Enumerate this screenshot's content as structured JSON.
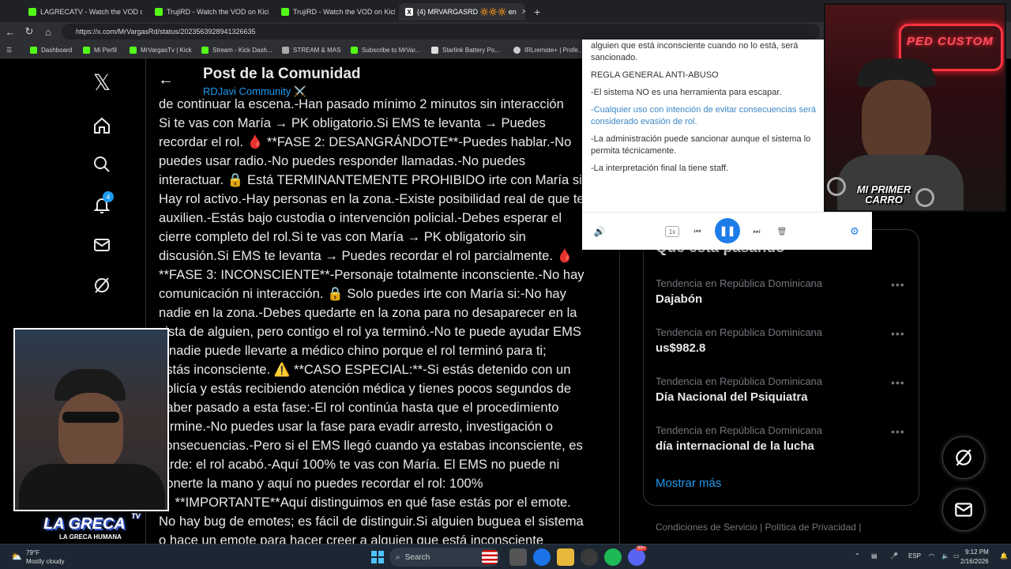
{
  "browser": {
    "tabs": [
      {
        "title": "LAGRECATV - Watch the VOD on K",
        "favicon": "kick-icon"
      },
      {
        "title": "TrujiRD - Watch the VOD on Kick",
        "favicon": "kick-icon"
      },
      {
        "title": "TrujiRD - Watch the VOD on Kick",
        "favicon": "kick-icon"
      },
      {
        "title": "(4) MRVARGASRD 🔆🔆🔆 en",
        "favicon": "x-icon"
      }
    ],
    "new_tab": "+",
    "url": "https://x.com/MrVargasRd/status/2023563928941326635",
    "bookmarks": [
      "Dashboard",
      "Mi Perfil",
      "MrVargasTv | Kick",
      "Stream - Kick Dash...",
      "STREAM & MAS",
      "Subscribe to MrVar...",
      "Starlink Battery Po...",
      "IRLremote+ | Profe..."
    ]
  },
  "sidebar": {
    "icons": [
      "x-logo-icon",
      "home-icon",
      "search-icon",
      "notifications-icon",
      "messages-icon",
      "grok-icon"
    ],
    "notification_count": "4"
  },
  "post": {
    "title": "Post de la Comunidad",
    "community": "RDJavi Community ⚔️",
    "lines": [
      "de continuar la escena.-Han pasado mínimo 2 minutos sin interacción",
      "Si te vas con María → PK obligatorio.Si EMS te levanta → Puedes",
      "recordar el rol. 🩸 **FASE 2: DESANGRÁNDOTE**-Puedes hablar.-No",
      "puedes usar radio.-No puedes responder llamadas.-No puedes",
      "interactuar. 🔒 Está TERMINANTEMENTE PROHIBIDO irte con María si:",
      "Hay rol activo.-Hay personas en la zona.-Existe posibilidad real de que te",
      "auxilien.-Estás bajo custodia o intervención policial.-Debes esperar el",
      "cierre completo del rol.Si te vas con María → PK obligatorio sin",
      "discusión.Si EMS te levanta → Puedes recordar el rol parcialmente. 🩸",
      "**FASE 3: INCONSCIENTE**-Personaje totalmente inconsciente.-No hay",
      "comunicación ni interacción. 🔒 Solo puedes irte con María si:-No hay",
      "nadie en la zona.-Debes quedarte en la zona para no desaparecer en la",
      "vista de alguien, pero contigo el rol ya terminó.-No te puede ayudar EMS",
      "y nadie puede llevarte a médico chino porque el rol terminó para ti;",
      "estás inconsciente. ⚠️ **CASO ESPECIAL:**-Si estás detenido con un",
      "policía y estás recibiendo atención médica y tienes pocos segundos de",
      "haber pasado a esta fase:-El rol continúa hasta que el procedimiento",
      "termine.-No puedes usar la fase para evadir arresto, investigación o",
      "consecuencias.-Pero si el EMS llegó cuando ya estabas inconsciente, es",
      "tarde: el rol acabó.-Aquí 100% te vas con María. El EMS no puede ni",
      "ponerte la mano y aquí no puedes recordar el rol: 100%",
      "❗**IMPORTANTE**Aquí distinguimos en qué fase estás por el emote.",
      "No hay bug de emotes; es fácil de distinguir.Si alguien buguea el sistema",
      "o hace un emote para hacer creer a alguien que está inconsciente"
    ]
  },
  "reader": {
    "paragraphs": [
      {
        "text": "alguien que está inconsciente cuando no lo está, será sancionado.",
        "highlight": false
      },
      {
        "text": "REGLA GENERAL ANTI-ABUSO",
        "highlight": false
      },
      {
        "text": "-El sistema NO es una herramienta para escapar.",
        "highlight": false
      },
      {
        "text": "-Cualquier uso con intención de evitar consecuencias será considerado evasión de rol.",
        "highlight": true
      },
      {
        "text": "-La administración puede sancionar aunque el sistema lo permita técnicamente.",
        "highlight": false
      },
      {
        "text": "-La interpretación final la tiene staff.",
        "highlight": false
      }
    ],
    "speed_label": "1x",
    "accent": "#1e7ce8"
  },
  "trends": {
    "title": "Qué está pasando",
    "items": [
      {
        "context": "Tendencia en República Dominicana",
        "name": "Dajabón"
      },
      {
        "context": "Tendencia en República Dominicana",
        "name": "us$982.8"
      },
      {
        "context": "Tendencia en República Dominicana",
        "name": "Día Nacional del Psiquiatra"
      },
      {
        "context": "Tendencia en República Dominicana",
        "name": "día internacional de la lucha"
      }
    ],
    "more_label": "•••",
    "show_more": "Mostrar más",
    "footer": "Condiciones de Servicio  |  Política de Privacidad  |"
  },
  "overlays": {
    "sign": "PED CUSTOM",
    "cam_caption": "MI PRIMER CARRO",
    "streamer_name": "LA GRECA",
    "streamer_sub": "LA GRECA HUMANA",
    "streamer_badge": "TV"
  },
  "taskbar": {
    "weather_temp": "79°F",
    "weather_desc": "Mostly cloudy",
    "search_label": "Search",
    "language": "ESP",
    "time": "9:12 PM",
    "date": "2/16/2026",
    "spotify_badge": "99+"
  },
  "colors": {
    "x_blue": "#1d9bf0",
    "text": "#e7e9ea",
    "muted": "#71767b",
    "kick_green": "#53fc18"
  }
}
